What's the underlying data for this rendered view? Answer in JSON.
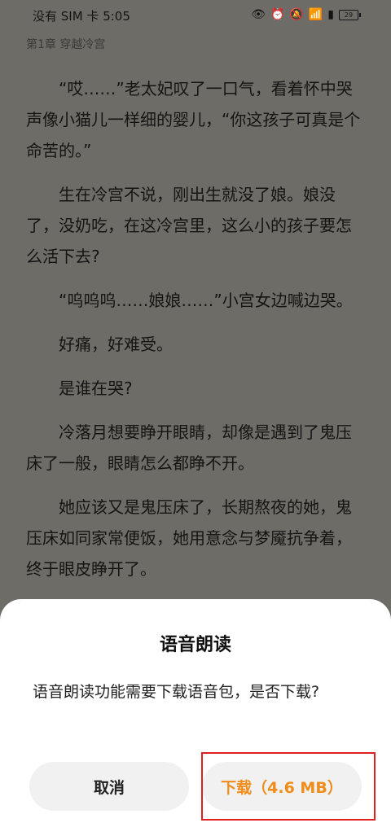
{
  "status_bar": {
    "carrier_time": "没有 SIM 卡 5:05",
    "icons": [
      "eye-icon",
      "alarm-icon",
      "mute-icon",
      "wifi-icon",
      "battery-saver-icon",
      "battery-icon"
    ],
    "battery_level": "29"
  },
  "reader": {
    "chapter_title": "第1章 穿越冷宫",
    "paragraphs": [
      "“哎……”老太妃叹了一口气，看着怀中哭声像小猫儿一样细的婴儿，“你这孩子可真是个命苦的。”",
      "生在冷宫不说，刚出生就没了娘。娘没了，没奶吃，在这冷宫里，这么小的孩子要怎么活下去?",
      "“呜呜呜……娘娘……”小宫女边喊边哭。",
      "好痛，好难受。",
      "是谁在哭?",
      "冷落月想要睁开眼睛，却像是遇到了鬼压床了一般，眼睛怎么都睁不开。",
      "她应该又是鬼压床了，长期熬夜的她，鬼压床如同家常便饭，她用意念与梦魇抗争着，终于眼皮睁开了。"
    ]
  },
  "dialog": {
    "title": "语音朗读",
    "message": "语音朗读功能需要下载语音包，是否下载?",
    "cancel_label": "取消",
    "download_label": "下载（4.6 MB）"
  },
  "colors": {
    "accent": "#f08c1a",
    "highlight": "#e02020",
    "dim_background": "#6e6c67"
  }
}
